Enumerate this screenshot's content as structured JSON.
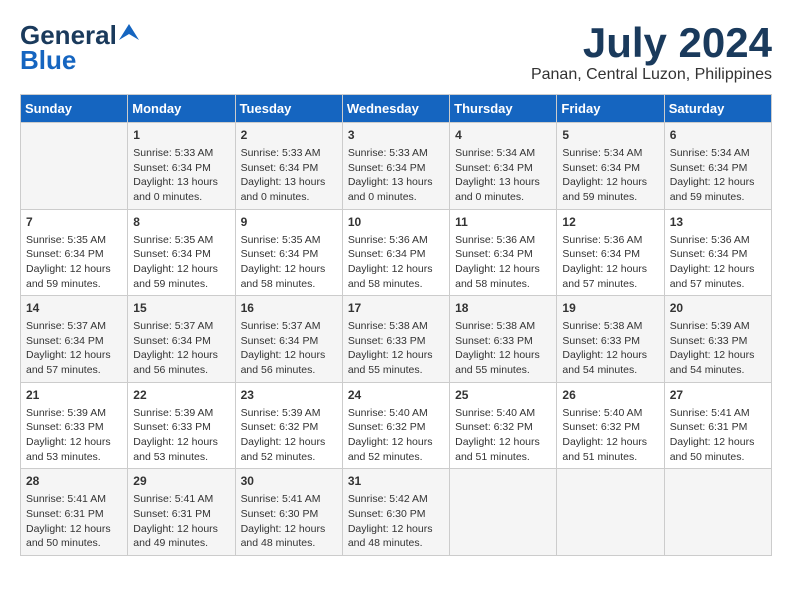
{
  "logo": {
    "line1": "General",
    "line2": "Blue"
  },
  "title": "July 2024",
  "location": "Panan, Central Luzon, Philippines",
  "days_of_week": [
    "Sunday",
    "Monday",
    "Tuesday",
    "Wednesday",
    "Thursday",
    "Friday",
    "Saturday"
  ],
  "weeks": [
    [
      {
        "day": "",
        "info": ""
      },
      {
        "day": "1",
        "info": "Sunrise: 5:33 AM\nSunset: 6:34 PM\nDaylight: 13 hours\nand 0 minutes."
      },
      {
        "day": "2",
        "info": "Sunrise: 5:33 AM\nSunset: 6:34 PM\nDaylight: 13 hours\nand 0 minutes."
      },
      {
        "day": "3",
        "info": "Sunrise: 5:33 AM\nSunset: 6:34 PM\nDaylight: 13 hours\nand 0 minutes."
      },
      {
        "day": "4",
        "info": "Sunrise: 5:34 AM\nSunset: 6:34 PM\nDaylight: 13 hours\nand 0 minutes."
      },
      {
        "day": "5",
        "info": "Sunrise: 5:34 AM\nSunset: 6:34 PM\nDaylight: 12 hours\nand 59 minutes."
      },
      {
        "day": "6",
        "info": "Sunrise: 5:34 AM\nSunset: 6:34 PM\nDaylight: 12 hours\nand 59 minutes."
      }
    ],
    [
      {
        "day": "7",
        "info": "Sunrise: 5:35 AM\nSunset: 6:34 PM\nDaylight: 12 hours\nand 59 minutes."
      },
      {
        "day": "8",
        "info": "Sunrise: 5:35 AM\nSunset: 6:34 PM\nDaylight: 12 hours\nand 59 minutes."
      },
      {
        "day": "9",
        "info": "Sunrise: 5:35 AM\nSunset: 6:34 PM\nDaylight: 12 hours\nand 58 minutes."
      },
      {
        "day": "10",
        "info": "Sunrise: 5:36 AM\nSunset: 6:34 PM\nDaylight: 12 hours\nand 58 minutes."
      },
      {
        "day": "11",
        "info": "Sunrise: 5:36 AM\nSunset: 6:34 PM\nDaylight: 12 hours\nand 58 minutes."
      },
      {
        "day": "12",
        "info": "Sunrise: 5:36 AM\nSunset: 6:34 PM\nDaylight: 12 hours\nand 57 minutes."
      },
      {
        "day": "13",
        "info": "Sunrise: 5:36 AM\nSunset: 6:34 PM\nDaylight: 12 hours\nand 57 minutes."
      }
    ],
    [
      {
        "day": "14",
        "info": "Sunrise: 5:37 AM\nSunset: 6:34 PM\nDaylight: 12 hours\nand 57 minutes."
      },
      {
        "day": "15",
        "info": "Sunrise: 5:37 AM\nSunset: 6:34 PM\nDaylight: 12 hours\nand 56 minutes."
      },
      {
        "day": "16",
        "info": "Sunrise: 5:37 AM\nSunset: 6:34 PM\nDaylight: 12 hours\nand 56 minutes."
      },
      {
        "day": "17",
        "info": "Sunrise: 5:38 AM\nSunset: 6:33 PM\nDaylight: 12 hours\nand 55 minutes."
      },
      {
        "day": "18",
        "info": "Sunrise: 5:38 AM\nSunset: 6:33 PM\nDaylight: 12 hours\nand 55 minutes."
      },
      {
        "day": "19",
        "info": "Sunrise: 5:38 AM\nSunset: 6:33 PM\nDaylight: 12 hours\nand 54 minutes."
      },
      {
        "day": "20",
        "info": "Sunrise: 5:39 AM\nSunset: 6:33 PM\nDaylight: 12 hours\nand 54 minutes."
      }
    ],
    [
      {
        "day": "21",
        "info": "Sunrise: 5:39 AM\nSunset: 6:33 PM\nDaylight: 12 hours\nand 53 minutes."
      },
      {
        "day": "22",
        "info": "Sunrise: 5:39 AM\nSunset: 6:33 PM\nDaylight: 12 hours\nand 53 minutes."
      },
      {
        "day": "23",
        "info": "Sunrise: 5:39 AM\nSunset: 6:32 PM\nDaylight: 12 hours\nand 52 minutes."
      },
      {
        "day": "24",
        "info": "Sunrise: 5:40 AM\nSunset: 6:32 PM\nDaylight: 12 hours\nand 52 minutes."
      },
      {
        "day": "25",
        "info": "Sunrise: 5:40 AM\nSunset: 6:32 PM\nDaylight: 12 hours\nand 51 minutes."
      },
      {
        "day": "26",
        "info": "Sunrise: 5:40 AM\nSunset: 6:32 PM\nDaylight: 12 hours\nand 51 minutes."
      },
      {
        "day": "27",
        "info": "Sunrise: 5:41 AM\nSunset: 6:31 PM\nDaylight: 12 hours\nand 50 minutes."
      }
    ],
    [
      {
        "day": "28",
        "info": "Sunrise: 5:41 AM\nSunset: 6:31 PM\nDaylight: 12 hours\nand 50 minutes."
      },
      {
        "day": "29",
        "info": "Sunrise: 5:41 AM\nSunset: 6:31 PM\nDaylight: 12 hours\nand 49 minutes."
      },
      {
        "day": "30",
        "info": "Sunrise: 5:41 AM\nSunset: 6:30 PM\nDaylight: 12 hours\nand 48 minutes."
      },
      {
        "day": "31",
        "info": "Sunrise: 5:42 AM\nSunset: 6:30 PM\nDaylight: 12 hours\nand 48 minutes."
      },
      {
        "day": "",
        "info": ""
      },
      {
        "day": "",
        "info": ""
      },
      {
        "day": "",
        "info": ""
      }
    ]
  ]
}
